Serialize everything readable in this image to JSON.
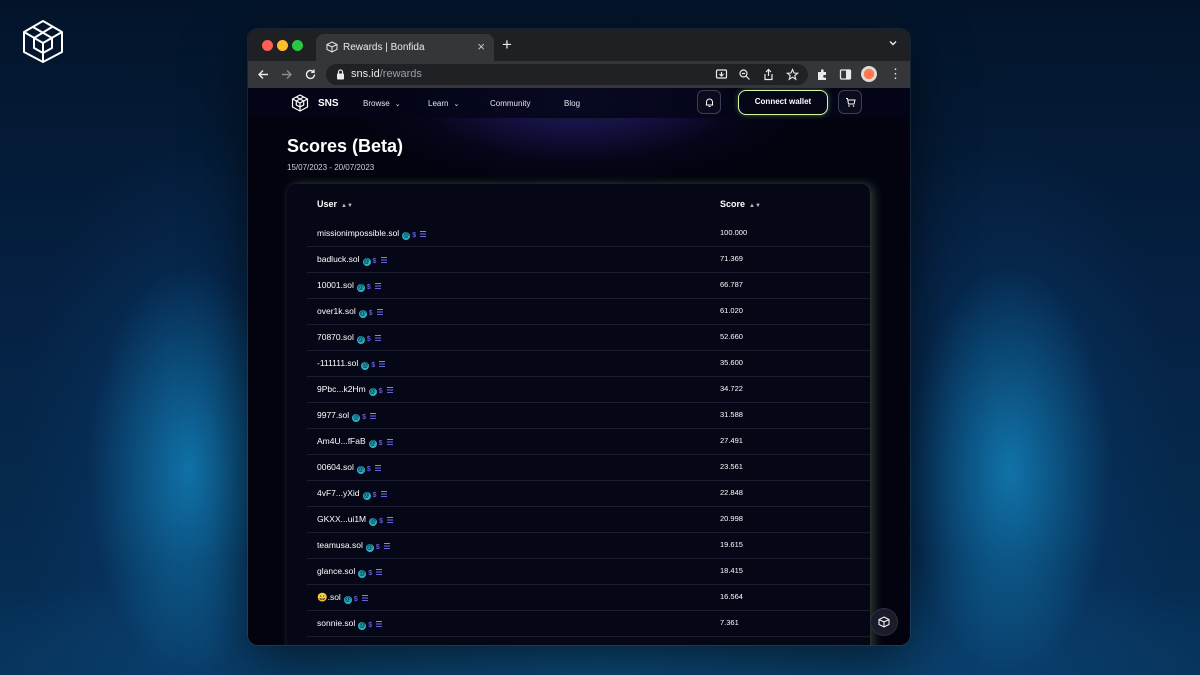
{
  "browser": {
    "tab_title": "Rewards | Bonfida",
    "new_tab": "+",
    "url_host": "sns.id",
    "url_path": "/rewards"
  },
  "site": {
    "brand": "SNS",
    "nav": {
      "browse": "Browse",
      "learn": "Learn",
      "community": "Community",
      "blog": "Blog"
    },
    "connect_wallet": "Connect wallet"
  },
  "page": {
    "title": "Scores (Beta)",
    "date_start": "15/07/2023",
    "date_sep": "-",
    "date_end": "20/07/2023"
  },
  "table": {
    "headers": {
      "user": "User",
      "score": "Score"
    },
    "rows": [
      {
        "user": "missionimpossible.sol",
        "score": "100.000"
      },
      {
        "user": "badluck.sol",
        "score": "71.369"
      },
      {
        "user": "10001.sol",
        "score": "66.787"
      },
      {
        "user": "over1k.sol",
        "score": "61.020"
      },
      {
        "user": "70870.sol",
        "score": "52.660"
      },
      {
        "user": "-111111.sol",
        "score": "35.600"
      },
      {
        "user": "9Pbc...k2Hm",
        "score": "34.722"
      },
      {
        "user": "9977.sol",
        "score": "31.588"
      },
      {
        "user": "Am4U...fFaB",
        "score": "27.491"
      },
      {
        "user": "00604.sol",
        "score": "23.561"
      },
      {
        "user": "4vF7...yXid",
        "score": "22.848"
      },
      {
        "user": "GKXX...ui1M",
        "score": "20.998"
      },
      {
        "user": "teamusa.sol",
        "score": "19.615"
      },
      {
        "user": "glance.sol",
        "score": "18.415"
      },
      {
        "user": "😀.sol",
        "score": "16.564"
      },
      {
        "user": "sonnie.sol",
        "score": "7.361"
      }
    ]
  },
  "icons": {
    "badge_at": "@",
    "badge_s": "$",
    "sort": "▲▼"
  },
  "colors": {
    "accent_border": "#d9f99d",
    "badge_teal": "#2ab3c7",
    "badge_purple": "#6b5bdb",
    "bg_dark": "#02030f"
  }
}
